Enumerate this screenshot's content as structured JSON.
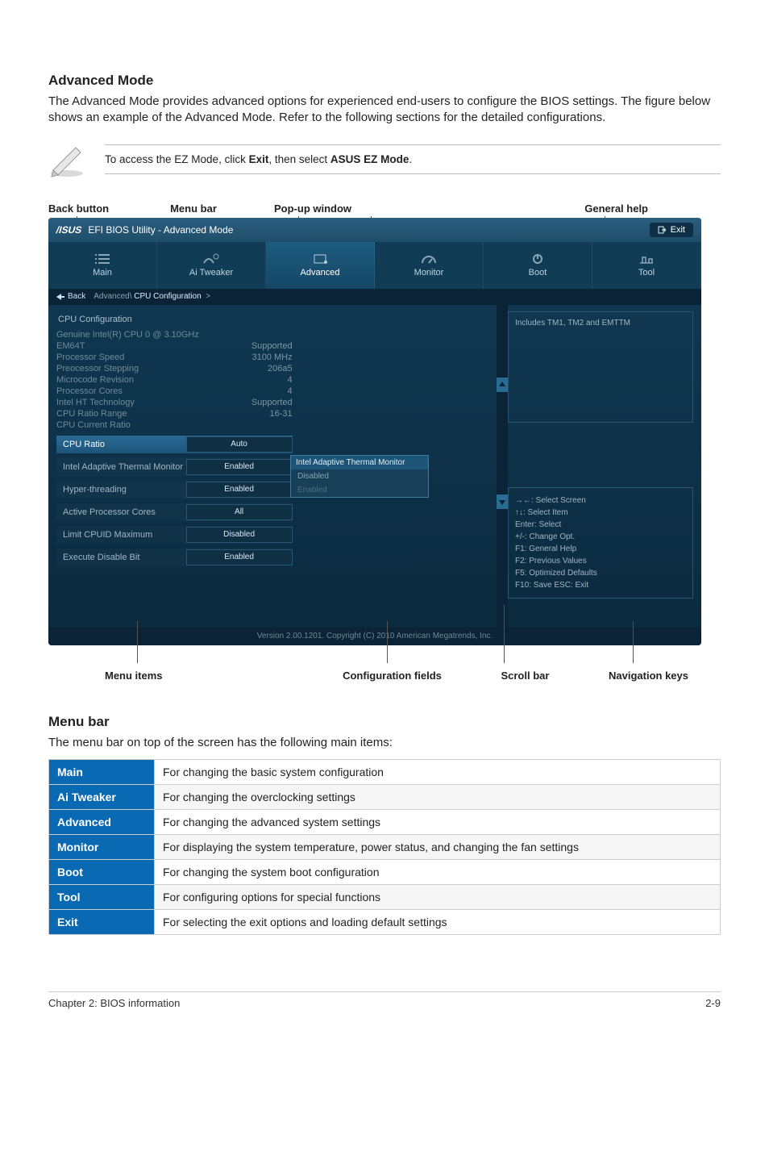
{
  "section1": {
    "heading": "Advanced Mode",
    "body": "The Advanced Mode provides advanced options for experienced end-users to configure the BIOS settings. The figure below shows an example of the Advanced Mode. Refer to the following sections for the detailed configurations.",
    "note_prefix": "To access the EZ Mode, click ",
    "note_b1": "Exit",
    "note_mid": ", then select ",
    "note_b2": "ASUS EZ Mode",
    "note_suffix": "."
  },
  "labels_top": {
    "back": "Back button",
    "menubar": "Menu bar",
    "popup": "Pop-up window",
    "general": "General help"
  },
  "bios": {
    "title": "EFI BIOS Utility - Advanced Mode",
    "exit": "Exit",
    "tabs": [
      "Main",
      "Ai  Tweaker",
      "Advanced",
      "Monitor",
      "Boot",
      "Tool"
    ],
    "crumb_back": "Back",
    "crumb_path": "Advanced\\ CPU Configuration  >",
    "hdr": "CPU Configuration",
    "info": [
      {
        "l": "Genuine Intel(R) CPU 0 @ 3.10GHz",
        "v": ""
      },
      {
        "l": "EM64T",
        "v": "Supported"
      },
      {
        "l": "Processor Speed",
        "v": "3100 MHz"
      },
      {
        "l": "Preocessor Stepping",
        "v": "206a5"
      },
      {
        "l": "Microcode Revision",
        "v": "4"
      },
      {
        "l": "Processor Cores",
        "v": "4"
      },
      {
        "l": "Intel HT Technology",
        "v": "Supported"
      },
      {
        "l": "CPU Ratio Range",
        "v": "16-31"
      },
      {
        "l": "CPU Current Ratio",
        "v": ""
      }
    ],
    "cfg": [
      {
        "l": "CPU Ratio",
        "v": "Auto",
        "sel": true
      },
      {
        "l": "Intel Adaptive Thermal Monitor",
        "v": "Enabled"
      },
      {
        "l": "Hyper-threading",
        "v": "Enabled"
      },
      {
        "l": "Active Processor Cores",
        "v": "All"
      },
      {
        "l": "Limit CPUID Maximum",
        "v": "Disabled"
      },
      {
        "l": "Execute Disable Bit",
        "v": "Enabled"
      }
    ],
    "popup_title": "Intel Adaptive Thermal Monitor",
    "popup_items": [
      "Disabled",
      "Enabled"
    ],
    "help_text": "Includes TM1, TM2 and EMTTM",
    "nav": [
      "→←:  Select Screen",
      "↑↓:  Select Item",
      "Enter:  Select",
      "+/-:  Change Opt.",
      "F1:  General Help",
      "F2:  Previous Values",
      "F5:  Optimized Defaults",
      "F10:  Save   ESC:  Exit"
    ],
    "footer": "Version  2.00.1201.  Copyright  (C)  2010  American  Megatrends,  Inc."
  },
  "labels_bot": {
    "menu_items": "Menu items",
    "cfg": "Configuration fields",
    "scroll": "Scroll bar",
    "nav": "Navigation keys"
  },
  "section2": {
    "heading": "Menu bar",
    "body": "The menu bar on top of the screen has the following main items:"
  },
  "table": [
    {
      "k": "Main",
      "v": "For changing the basic system configuration"
    },
    {
      "k": "Ai Tweaker",
      "v": "For changing the overclocking settings"
    },
    {
      "k": "Advanced",
      "v": "For changing the advanced system settings"
    },
    {
      "k": "Monitor",
      "v": "For displaying the system temperature, power status, and changing the fan settings"
    },
    {
      "k": "Boot",
      "v": "For changing the system boot configuration"
    },
    {
      "k": "Tool",
      "v": "For configuring options for special functions"
    },
    {
      "k": "Exit",
      "v": "For selecting the exit options and loading default settings"
    }
  ],
  "footer": {
    "left": "Chapter 2: BIOS information",
    "right": "2-9"
  }
}
